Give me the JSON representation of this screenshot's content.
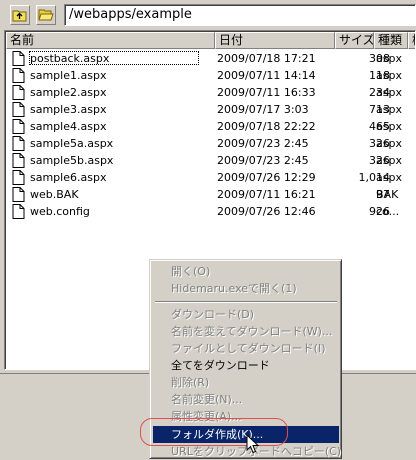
{
  "toolbar": {
    "up_button": "up-folder-icon",
    "open_button": "open-folder-icon",
    "path": "/webapps/example"
  },
  "columns": [
    "名前",
    "日付",
    "サイズ",
    "種類",
    "権"
  ],
  "files": [
    {
      "name": "postback.aspx",
      "date": "2009/07/18 17:21",
      "size": "308",
      "type": "aspx"
    },
    {
      "name": "sample1.aspx",
      "date": "2009/07/11 14:14",
      "size": "118",
      "type": "aspx"
    },
    {
      "name": "sample2.aspx",
      "date": "2009/07/11 16:33",
      "size": "234",
      "type": "aspx"
    },
    {
      "name": "sample3.aspx",
      "date": "2009/07/17 3:03",
      "size": "713",
      "type": "aspx"
    },
    {
      "name": "sample4.aspx",
      "date": "2009/07/18 22:22",
      "size": "465",
      "type": "aspx"
    },
    {
      "name": "sample5a.aspx",
      "date": "2009/07/23 2:45",
      "size": "326",
      "type": "aspx"
    },
    {
      "name": "sample5b.aspx",
      "date": "2009/07/23 2:45",
      "size": "326",
      "type": "aspx"
    },
    {
      "name": "sample6.aspx",
      "date": "2009/07/26 12:29",
      "size": "1,014",
      "type": "aspx"
    },
    {
      "name": "web.BAK",
      "date": "2009/07/11 16:21",
      "size": "97",
      "type": "BAK"
    },
    {
      "name": "web.config",
      "date": "2009/07/26 12:46",
      "size": "926",
      "type": "co..."
    }
  ],
  "context_menu": {
    "open": "開く(O)",
    "open_hidemaru": "Hidemaru.exeで開く(1)",
    "download": "ダウンロード(D)",
    "rename_download": "名前を変えてダウンロード(W)...",
    "download_as_file": "ファイルとしてダウンロード(I)",
    "download_all": "全てをダウンロード",
    "delete": "削除(R)",
    "rename": "名前変更(N)...",
    "change_attributes": "属性変更(A)...",
    "make_folder": "フォルダ作成(K)...",
    "copy_url": "URLをクリップボードへコピー(C)"
  },
  "colors": {
    "selection": "#0a246a",
    "annotation": "#e05050",
    "face": "#d4d0c8"
  }
}
